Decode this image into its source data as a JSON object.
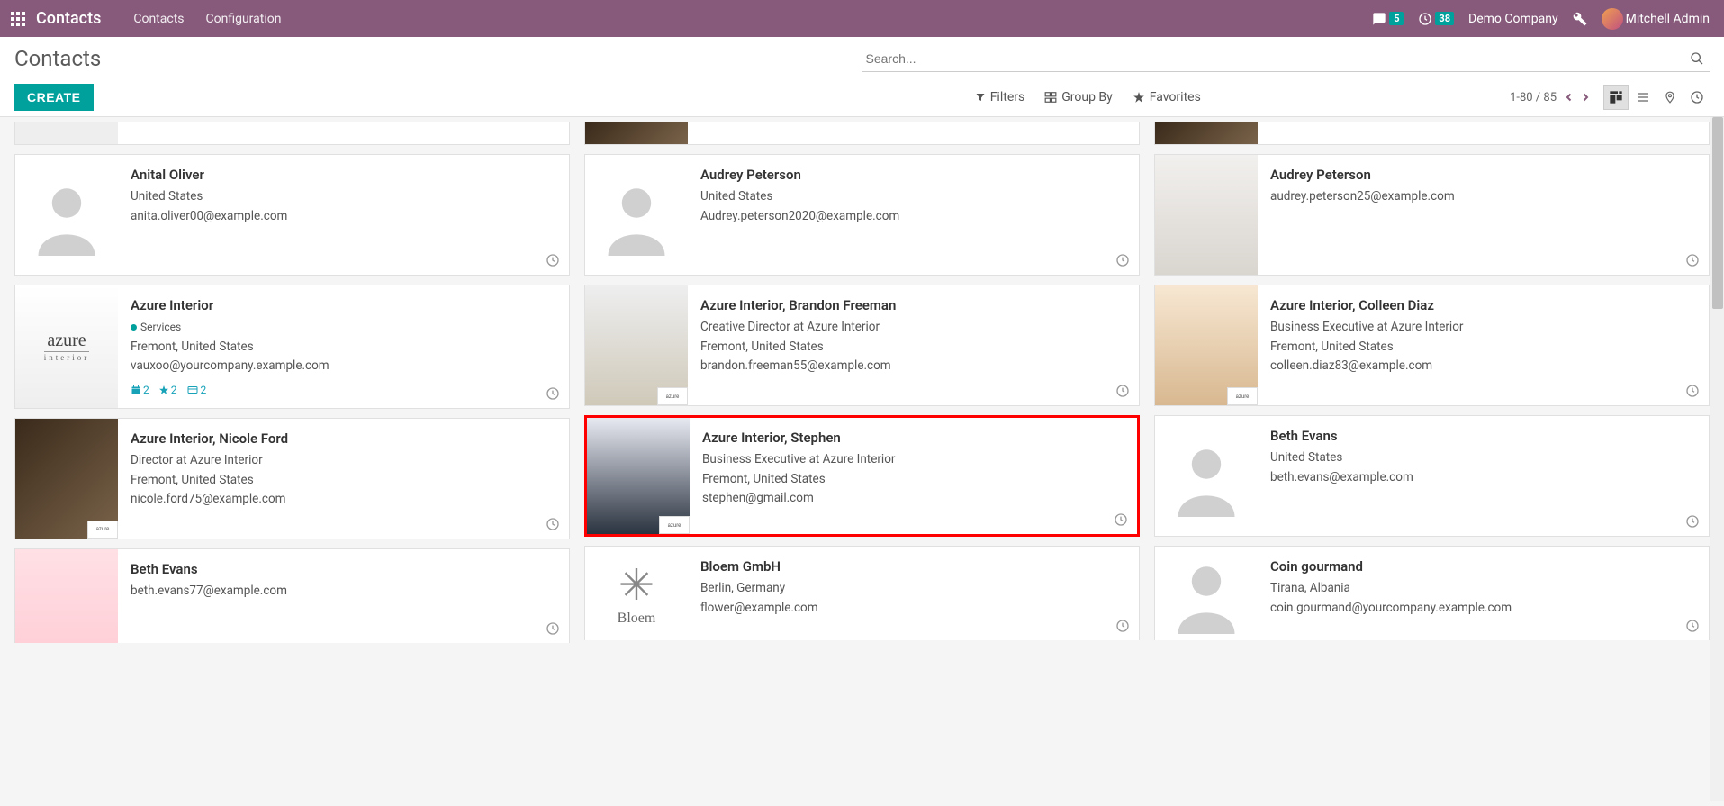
{
  "topnav": {
    "brand": "Contacts",
    "menus": [
      "Contacts",
      "Configuration"
    ],
    "messages_count": "5",
    "activities_count": "38",
    "company": "Demo Company",
    "user": "Mitchell Admin"
  },
  "control": {
    "breadcrumb": "Contacts",
    "search_placeholder": "Search...",
    "create_label": "CREATE",
    "filters_label": "Filters",
    "groupby_label": "Group By",
    "favorites_label": "Favorites",
    "pager": "1-80 / 85"
  },
  "cards": {
    "col1": [
      {
        "name": "",
        "lines": [],
        "partial": "top"
      },
      {
        "name": "Anital Oliver",
        "lines": [
          "United States",
          "anita.oliver00@example.com"
        ],
        "img": "placeholder"
      },
      {
        "name": "Azure Interior",
        "tag": "Services",
        "lines": [
          "Fremont, United States",
          "vauxoo@yourcompany.example.com"
        ],
        "img": "azure-logo",
        "indicators": [
          {
            "icon": "calendar",
            "val": "2"
          },
          {
            "icon": "star",
            "val": "2"
          },
          {
            "icon": "card",
            "val": "2"
          }
        ]
      },
      {
        "name": "Azure Interior, Nicole Ford",
        "lines": [
          "Director at Azure Interior",
          "Fremont, United States",
          "nicole.ford75@example.com"
        ],
        "img": "photo",
        "tint": "p2",
        "badge": "azure"
      },
      {
        "name": "Beth Evans",
        "lines": [
          "beth.evans77@example.com"
        ],
        "img": "photo",
        "tint": "p6",
        "partial": "bottom"
      }
    ],
    "col2": [
      {
        "name": "",
        "lines": [],
        "img": "photo",
        "tint": "p2",
        "partial": "top"
      },
      {
        "name": "Audrey Peterson",
        "lines": [
          "United States",
          "Audrey.peterson2020@example.com"
        ],
        "img": "placeholder"
      },
      {
        "name": "Azure Interior, Brandon Freeman",
        "lines": [
          "Creative Director at Azure Interior",
          "Fremont, United States",
          "brandon.freeman55@example.com"
        ],
        "img": "photo",
        "tint": "p3",
        "badge": "azure"
      },
      {
        "name": "Azure Interior, Stephen",
        "lines": [
          "Business Executive at Azure Interior",
          "Fremont, United States",
          "stephen@gmail.com"
        ],
        "img": "photo",
        "tint": "p7",
        "badge": "azure",
        "highlight": true
      },
      {
        "name": "Bloem GmbH",
        "lines": [
          "Berlin, Germany",
          "flower@example.com"
        ],
        "img": "bloem",
        "partial": "bottom"
      }
    ],
    "col3": [
      {
        "name": "",
        "lines": [],
        "img": "photo",
        "tint": "p2",
        "partial": "top"
      },
      {
        "name": "Audrey Peterson",
        "lines": [
          "audrey.peterson25@example.com"
        ],
        "img": "photo",
        "tint": "p1"
      },
      {
        "name": "Azure Interior, Colleen Diaz",
        "lines": [
          "Business Executive at Azure Interior",
          "Fremont, United States",
          "colleen.diaz83@example.com"
        ],
        "img": "photo",
        "tint": "p4",
        "badge": "azure"
      },
      {
        "name": "Beth Evans",
        "lines": [
          "United States",
          "beth.evans@example.com"
        ],
        "img": "placeholder"
      },
      {
        "name": "Coin gourmand",
        "lines": [
          "Tirana, Albania",
          "coin.gourmand@yourcompany.example.com"
        ],
        "img": "placeholder",
        "partial": "bottom"
      }
    ]
  }
}
